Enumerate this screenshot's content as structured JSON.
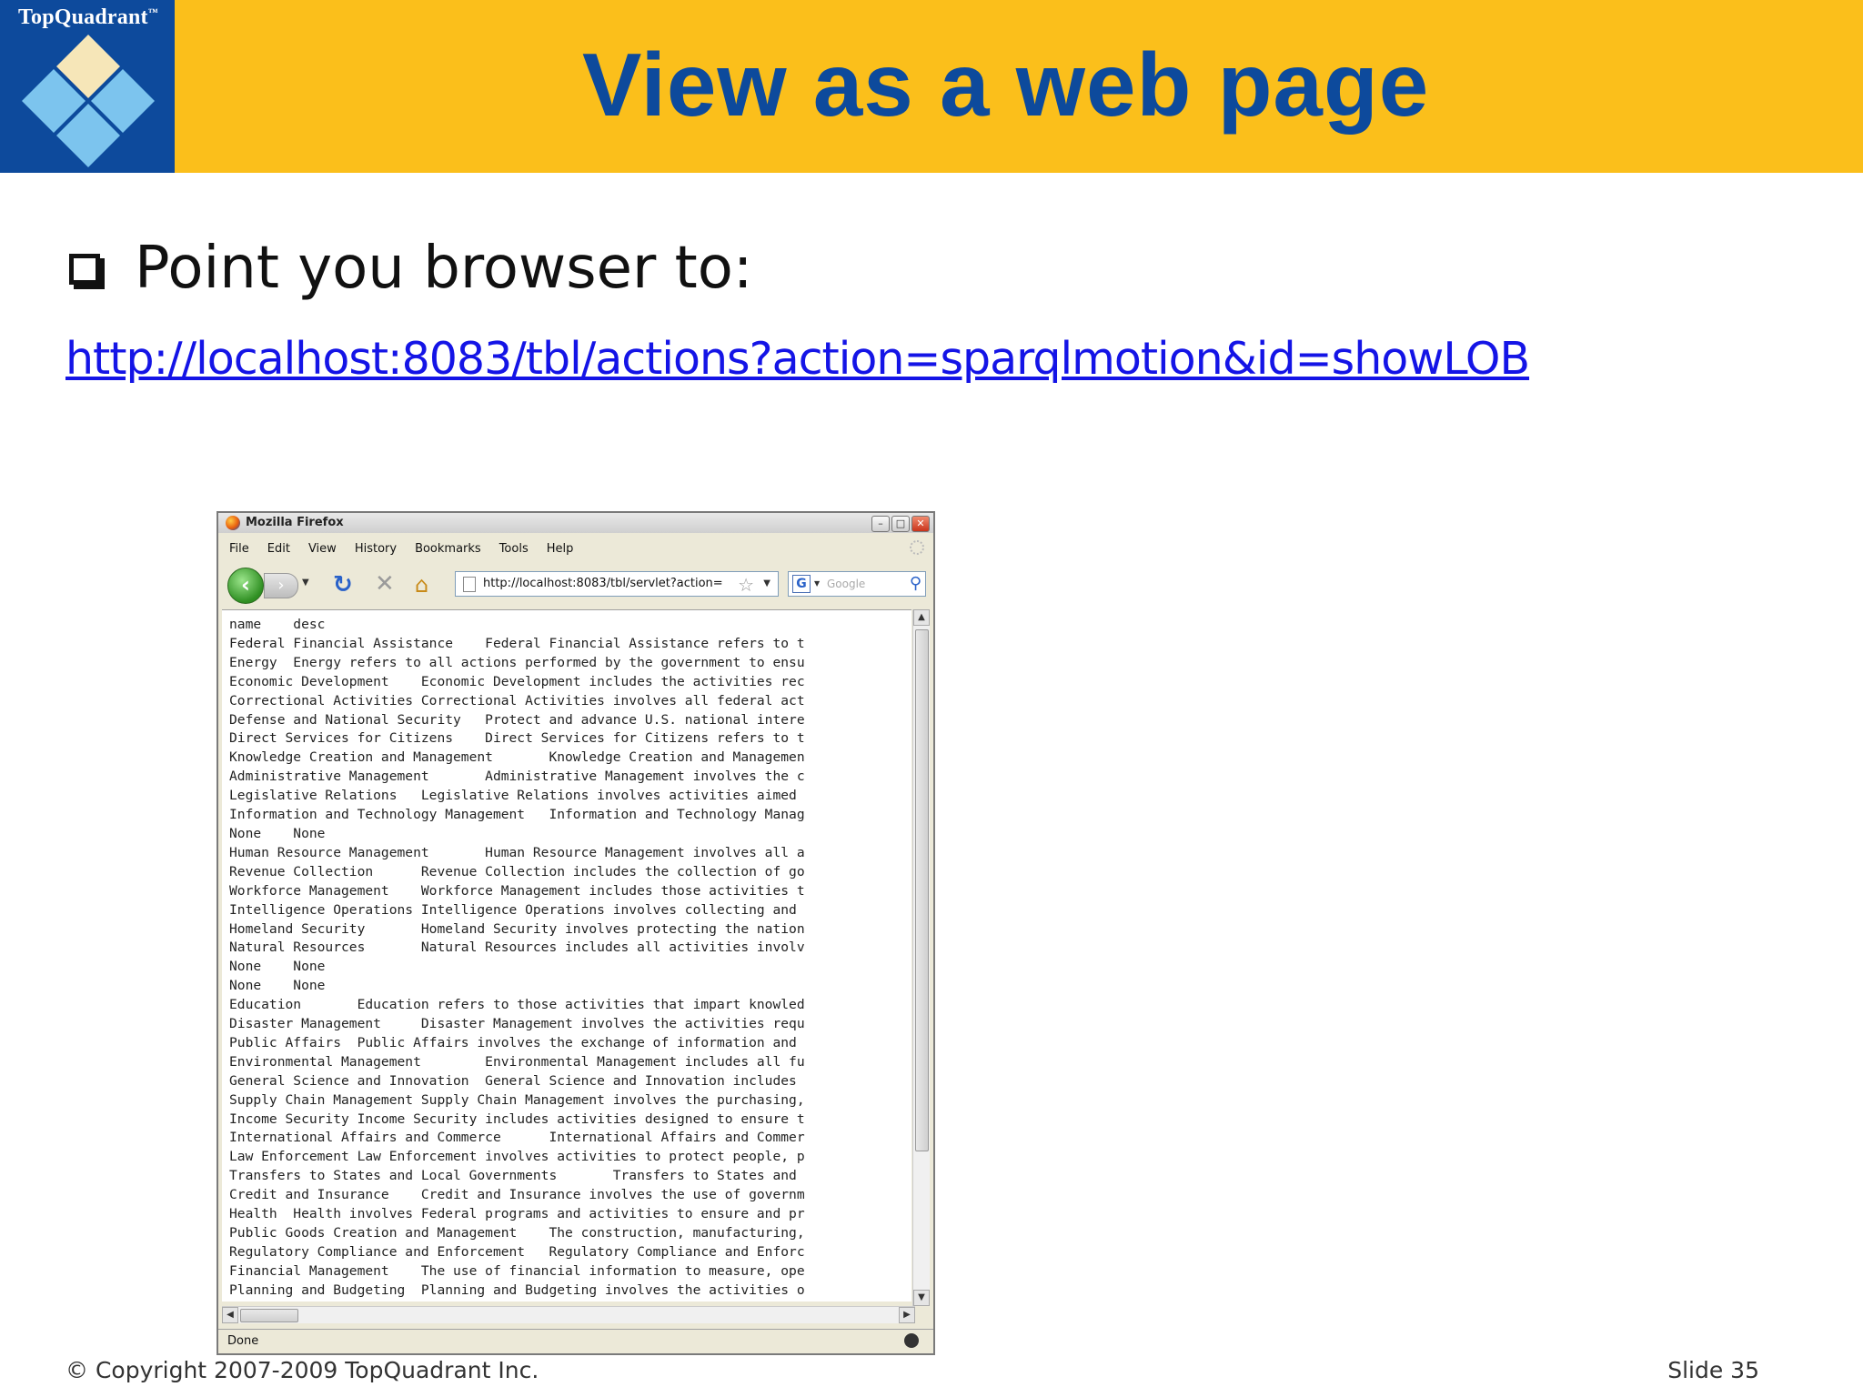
{
  "logo": {
    "text": "TopQuadrant",
    "trademark": "™"
  },
  "slide": {
    "title": "View as a web page",
    "bullet": "Point you browser to:",
    "url": "http://localhost:8083/tbl/actions?action=sparqlmotion&id=showLOB",
    "copyright": "© Copyright 2007-2009 TopQuadrant Inc.",
    "slide_number": "Slide 35"
  },
  "colors": {
    "header": "#fbbf1b",
    "logo_bg": "#0d4a9c",
    "title": "#0d4a9c",
    "link": "#1414e6"
  },
  "browser": {
    "window_title": "Mozilla Firefox",
    "menu": [
      "File",
      "Edit",
      "View",
      "History",
      "Bookmarks",
      "Tools",
      "Help"
    ],
    "address": "http://localhost:8083/tbl/servlet?action=",
    "search_engine": "G",
    "search_placeholder": "Google",
    "status": "Done",
    "content_lines": [
      "name    desc",
      "Federal Financial Assistance    Federal Financial Assistance refers to t",
      "Energy  Energy refers to all actions performed by the government to ensu",
      "Economic Development    Economic Development includes the activities rec",
      "Correctional Activities Correctional Activities involves all federal act",
      "Defense and National Security   Protect and advance U.S. national intere",
      "Direct Services for Citizens    Direct Services for Citizens refers to t",
      "Knowledge Creation and Management       Knowledge Creation and Managemen",
      "Administrative Management       Administrative Management involves the c",
      "Legislative Relations   Legislative Relations involves activities aimed",
      "Information and Technology Management   Information and Technology Manag",
      "None    None",
      "Human Resource Management       Human Resource Management involves all a",
      "Revenue Collection      Revenue Collection includes the collection of go",
      "Workforce Management    Workforce Management includes those activities t",
      "Intelligence Operations Intelligence Operations involves collecting and",
      "Homeland Security       Homeland Security involves protecting the nation",
      "Natural Resources       Natural Resources includes all activities involv",
      "None    None",
      "None    None",
      "Education       Education refers to those activities that impart knowled",
      "Disaster Management     Disaster Management involves the activities requ",
      "Public Affairs  Public Affairs involves the exchange of information and",
      "Environmental Management        Environmental Management includes all fu",
      "General Science and Innovation  General Science and Innovation includes",
      "Supply Chain Management Supply Chain Management involves the purchasing,",
      "Income Security Income Security includes activities designed to ensure t",
      "International Affairs and Commerce      International Affairs and Commer",
      "Law Enforcement Law Enforcement involves activities to protect people, p",
      "Transfers to States and Local Governments       Transfers to States and",
      "Credit and Insurance    Credit and Insurance involves the use of governm",
      "Health  Health involves Federal programs and activities to ensure and pr",
      "Public Goods Creation and Management    The construction, manufacturing,",
      "Regulatory Compliance and Enforcement   Regulatory Compliance and Enforc",
      "Financial Management    The use of financial information to measure, ope",
      "Planning and Budgeting  Planning and Budgeting involves the activities o"
    ]
  }
}
